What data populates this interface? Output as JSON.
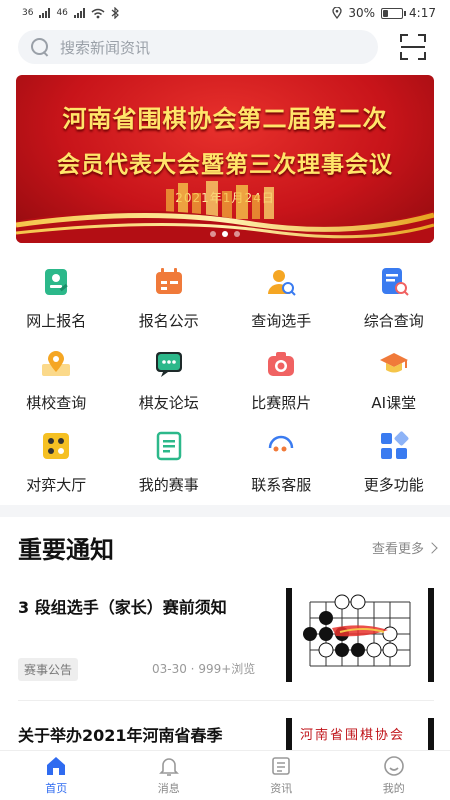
{
  "status_bar": {
    "left_indicators": [
      "36",
      "46"
    ],
    "battery": "30%",
    "battery_level": 0.3,
    "time": "4:17"
  },
  "search": {
    "placeholder": "搜索新闻资讯"
  },
  "banner": {
    "line1": "河南省围棋协会第二届第二次",
    "line2": "会员代表大会暨第三次理事会议",
    "date": "2021年1月24日",
    "slide_count": 3,
    "active_slide": 2
  },
  "features": [
    {
      "label": "网上报名",
      "icon": "register-icon",
      "color": "#2cb88a"
    },
    {
      "label": "报名公示",
      "icon": "calendar-icon",
      "color": "#f07a3a"
    },
    {
      "label": "查询选手",
      "icon": "user-search-icon",
      "color": "#f5a623"
    },
    {
      "label": "综合查询",
      "icon": "document-search-icon",
      "color": "#3a7bf0"
    },
    {
      "label": "棋校查询",
      "icon": "map-pin-icon",
      "color": "#f5a623"
    },
    {
      "label": "棋友论坛",
      "icon": "chat-icon",
      "color": "#2cb88a"
    },
    {
      "label": "比赛照片",
      "icon": "camera-icon",
      "color": "#f06262"
    },
    {
      "label": "AI课堂",
      "icon": "graduation-cap-icon",
      "color": "#f07a3a"
    },
    {
      "label": "对弈大厅",
      "icon": "game-board-icon",
      "color": "#f5c023"
    },
    {
      "label": "我的赛事",
      "icon": "list-doc-icon",
      "color": "#2cb88a"
    },
    {
      "label": "联系客服",
      "icon": "support-icon",
      "color": "#3a7bf0"
    },
    {
      "label": "更多功能",
      "icon": "grid-more-icon",
      "color": "#3a7bf0"
    }
  ],
  "notices": {
    "title": "重要通知",
    "more_label": "查看更多",
    "items": [
      {
        "title": "3 段组选手（家长）赛前须知",
        "tag": "赛事公告",
        "meta": "03-30 · 999+浏览"
      },
      {
        "title": "关于举办2021年河南省春季",
        "thumb_text": "河南省围棋协会"
      }
    ]
  },
  "tabbar": {
    "tabs": [
      {
        "label": "首页",
        "active": true
      },
      {
        "label": "消息",
        "active": false
      },
      {
        "label": "资讯",
        "active": false
      },
      {
        "label": "我的",
        "active": false
      }
    ]
  },
  "colors": {
    "accent": "#2f6bf0",
    "banner_red": "#c8141a",
    "banner_text": "#ffe56a"
  }
}
